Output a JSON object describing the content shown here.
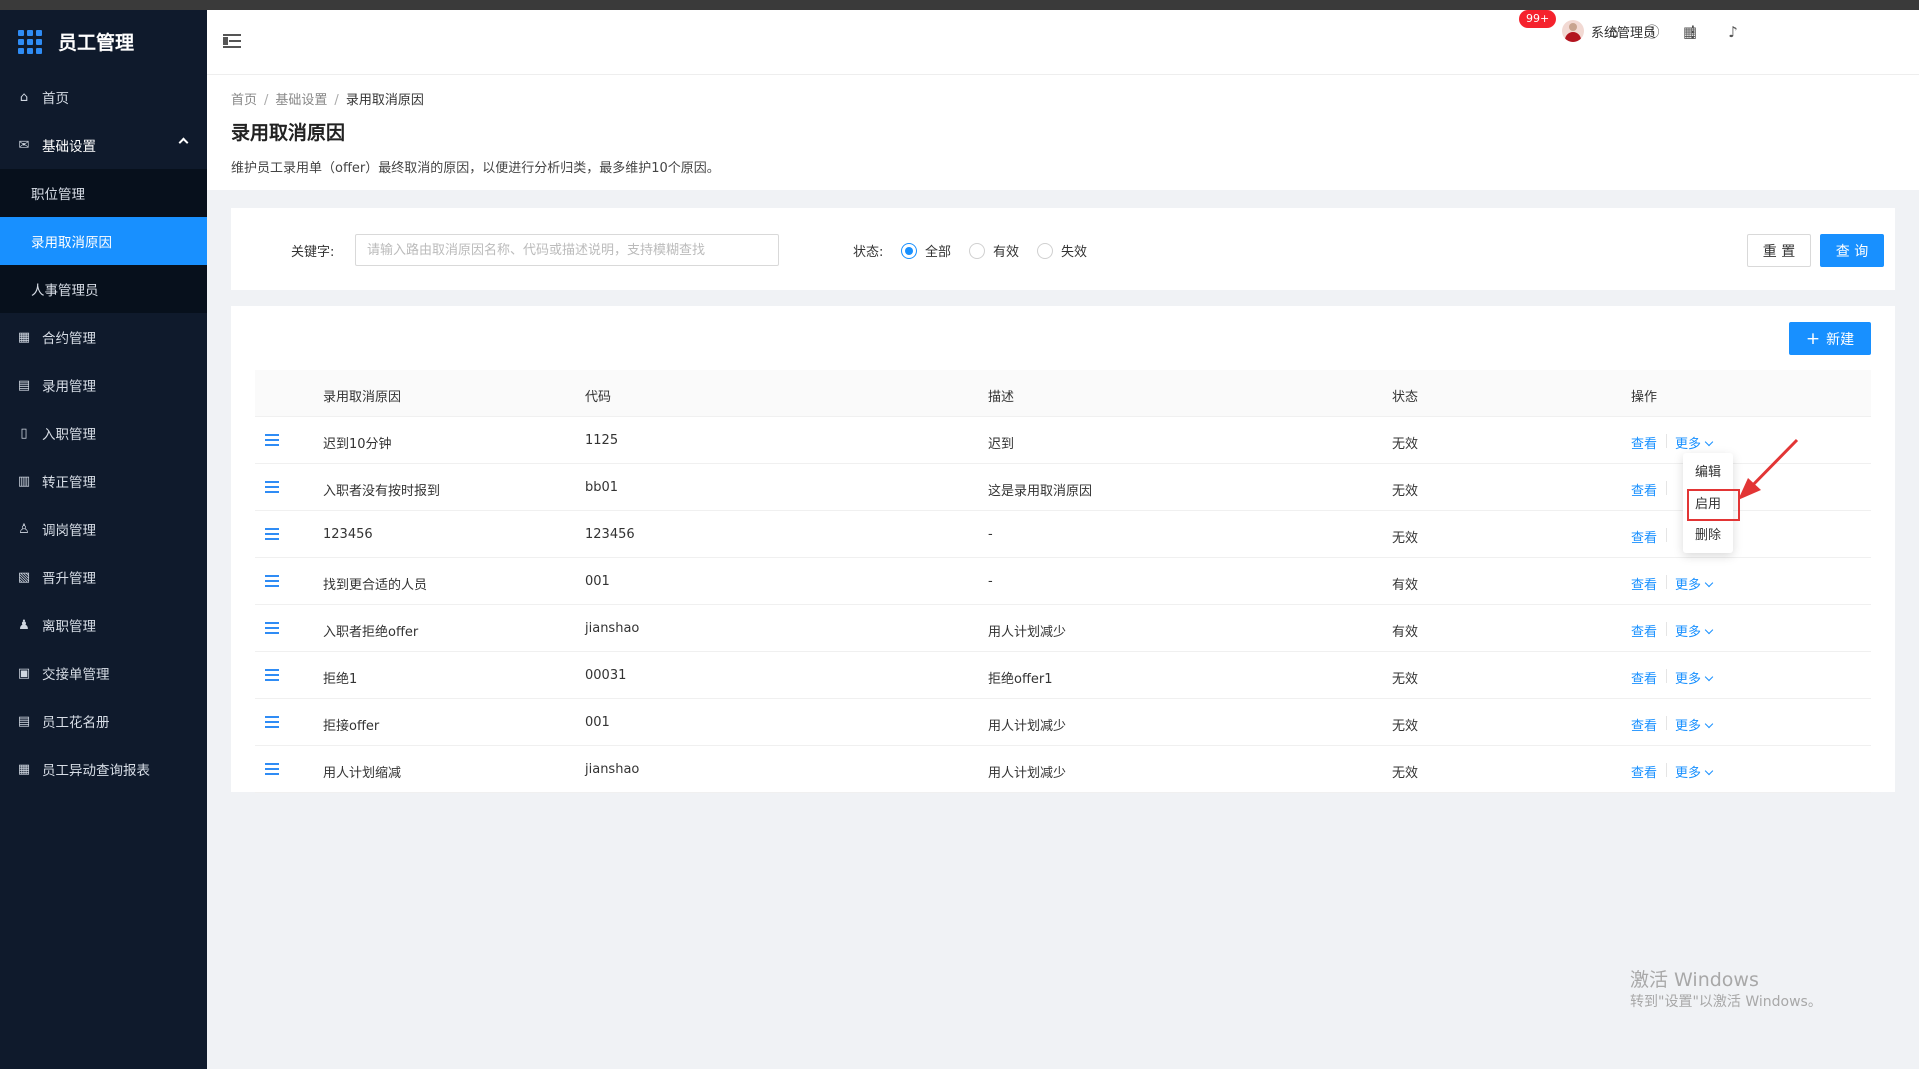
{
  "app": {
    "title": "员工管理"
  },
  "sidebar": {
    "items": [
      {
        "label": "首页",
        "icon": "home-icon"
      },
      {
        "label": "基础设置",
        "icon": "mail-icon"
      },
      {
        "label": "合约管理",
        "icon": "calendar-icon"
      },
      {
        "label": "录用管理",
        "icon": "folder-icon"
      },
      {
        "label": "入职管理",
        "icon": "document-icon"
      },
      {
        "label": "转正管理",
        "icon": "grid-icon"
      },
      {
        "label": "调岗管理",
        "icon": "user-icon"
      },
      {
        "label": "晋升管理",
        "icon": "form-icon"
      },
      {
        "label": "离职管理",
        "icon": "user-leave-icon"
      },
      {
        "label": "交接单管理",
        "icon": "handover-icon"
      },
      {
        "label": "员工花名册",
        "icon": "roster-icon"
      },
      {
        "label": "员工异动查询报表",
        "icon": "report-icon"
      }
    ],
    "submenu": [
      "职位管理",
      "录用取消原因",
      "人事管理员"
    ]
  },
  "header": {
    "badge": "99+",
    "username": "系统管理员",
    "icons": [
      "home-icon",
      "help-icon",
      "apps-icon",
      "bell-icon"
    ]
  },
  "page": {
    "breadcrumb": [
      "首页",
      "基础设置",
      "录用取消原因"
    ],
    "title": "录用取消原因",
    "description": "维护员工录用单（offer）最终取消的原因，以便进行分析归类，最多维护10个原因。"
  },
  "filter": {
    "keyword_label": "关键字:",
    "keyword_placeholder": "请输入路由取消原因名称、代码或描述说明，支持模糊查找",
    "keyword_value": "",
    "status_label": "状态:",
    "status_options": [
      "全部",
      "有效",
      "失效"
    ],
    "status_selected": "全部",
    "reset_label": "重 置",
    "query_label": "查 询"
  },
  "table": {
    "new_label": "新建",
    "columns": [
      "录用取消原因",
      "代码",
      "描述",
      "状态",
      "操作"
    ],
    "rows": [
      {
        "reason": "迟到10分钟",
        "code": "1125",
        "desc": "迟到",
        "status": "无效"
      },
      {
        "reason": "入职者没有按时报到",
        "code": "bb01",
        "desc": "这是录用取消原因",
        "status": "无效"
      },
      {
        "reason": "123456",
        "code": "123456",
        "desc": "-",
        "status": "无效"
      },
      {
        "reason": "找到更合适的人员",
        "code": "001",
        "desc": "-",
        "status": "有效"
      },
      {
        "reason": "入职者拒绝offer",
        "code": "jianshao",
        "desc": "用人计划减少",
        "status": "有效"
      },
      {
        "reason": "拒绝1",
        "code": "00031",
        "desc": "拒绝offer1",
        "status": "无效"
      },
      {
        "reason": "拒接offer",
        "code": "001",
        "desc": "用人计划减少",
        "status": "无效"
      },
      {
        "reason": "用人计划缩减",
        "code": "jianshao",
        "desc": "用人计划减少",
        "status": "无效"
      }
    ],
    "view_label": "查看",
    "more_label": "更多"
  },
  "dropdown": {
    "items": [
      "编辑",
      "启用",
      "删除"
    ],
    "highlighted": "启用"
  },
  "watermark": {
    "line1": "激活 Windows",
    "line2": "转到\"设置\"以激活 Windows。"
  },
  "colors": {
    "primary": "#1890ff",
    "sidebar": "#0f1a2c",
    "highlight": "#e23535"
  }
}
